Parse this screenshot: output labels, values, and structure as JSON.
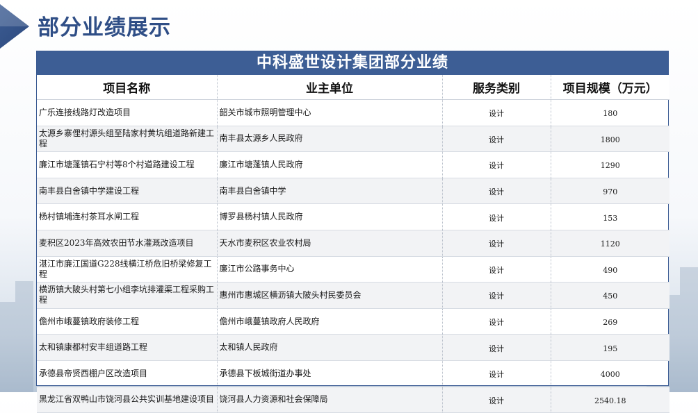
{
  "page": {
    "title": "部分业绩展示"
  },
  "table": {
    "banner": "中科盛世设计集团部分业绩",
    "headers": [
      "项目名称",
      "业主单位",
      "服务类别",
      "项目规模（万元）"
    ],
    "rows": [
      [
        "广乐连接线路灯改造项目",
        "韶关市城市照明管理中心",
        "设计",
        "180"
      ],
      [
        "太源乡寨俚村源头组至陆家村黄坑组道路新建工程",
        "南丰县太源乡人民政府",
        "设计",
        "1800"
      ],
      [
        "廉江市塘蓬镇石宁村等8个村道路建设工程",
        "廉江市塘蓬镇人民政府",
        "设计",
        "1290"
      ],
      [
        "南丰县白舍镇中学建设工程",
        "南丰县白舍镇中学",
        "设计",
        "970"
      ],
      [
        "杨村镇埔连村茶耳水闸工程",
        "博罗县杨村镇人民政府",
        "设计",
        "153"
      ],
      [
        "麦积区2023年高效农田节水灌溉改造项目",
        "天水市麦积区农业农村局",
        "设计",
        "1120"
      ],
      [
        "湛江市廉江国道G228线横江桥危旧桥梁修复工程",
        "廉江市公路事务中心",
        "设计",
        "490"
      ],
      [
        "横沥镇大陂头村第七小组李坑排灌渠工程采购工程",
        "惠州市惠城区横沥镇大陂头村民委员会",
        "设计",
        "450"
      ],
      [
        "儋州市峨蔓镇政府装修工程",
        "儋州市峨蔓镇政府人民政府",
        "设计",
        "269"
      ],
      [
        "太和镇康都村安丰组道路工程",
        "太和镇人民政府",
        "设计",
        "195"
      ],
      [
        "承德县帝贤西棚户区改造项目",
        "承德县下板城街道办事处",
        "设计",
        "4000"
      ],
      [
        "黑龙江省双鸭山市饶河县公共实训基地建设项目",
        "饶河县人力资源和社会保障局",
        "设计",
        "2540.18"
      ]
    ]
  }
}
